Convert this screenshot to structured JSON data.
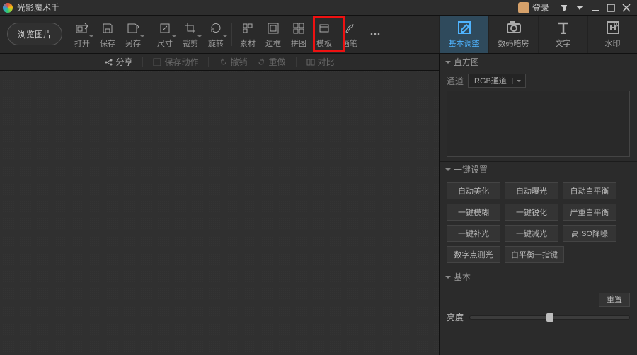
{
  "title": "光影魔术手",
  "login_label": "登录",
  "browse_label": "浏览图片",
  "tools": [
    {
      "id": "open",
      "label": "打开",
      "dd": true
    },
    {
      "id": "save",
      "label": "保存"
    },
    {
      "id": "saveas",
      "label": "另存",
      "dd": true
    },
    {
      "id": "size",
      "label": "尺寸",
      "dd": true
    },
    {
      "id": "crop",
      "label": "裁剪",
      "dd": true
    },
    {
      "id": "rotate",
      "label": "旋转",
      "dd": true
    },
    {
      "id": "material",
      "label": "素材"
    },
    {
      "id": "frame",
      "label": "边框"
    },
    {
      "id": "collage",
      "label": "拼图"
    },
    {
      "id": "template",
      "label": "模板"
    },
    {
      "id": "brush",
      "label": "画笔"
    },
    {
      "id": "more",
      "label": ""
    }
  ],
  "right_tabs": [
    {
      "id": "basicadj",
      "label": "基本调整"
    },
    {
      "id": "darkroom",
      "label": "数码暗房"
    },
    {
      "id": "text",
      "label": "文字"
    },
    {
      "id": "watermark",
      "label": "水印"
    }
  ],
  "secbar": {
    "share": "分享",
    "saveaction": "保存动作",
    "undo": "撤销",
    "redo": "重做",
    "compare": "对比"
  },
  "panel": {
    "histogram": {
      "title": "直方图",
      "channel_label": "通道",
      "channel_value": "RGB通道"
    },
    "oneclick": {
      "title": "一键设置",
      "buttons": [
        "自动美化",
        "自动曝光",
        "自动白平衡",
        "一键模糊",
        "一键锐化",
        "严重白平衡",
        "一键补光",
        "一键减光",
        "高ISO降噪",
        "数字点测光",
        "白平衡一指键"
      ]
    },
    "basic": {
      "title": "基本",
      "reset": "重置",
      "brightness": "亮度"
    }
  }
}
